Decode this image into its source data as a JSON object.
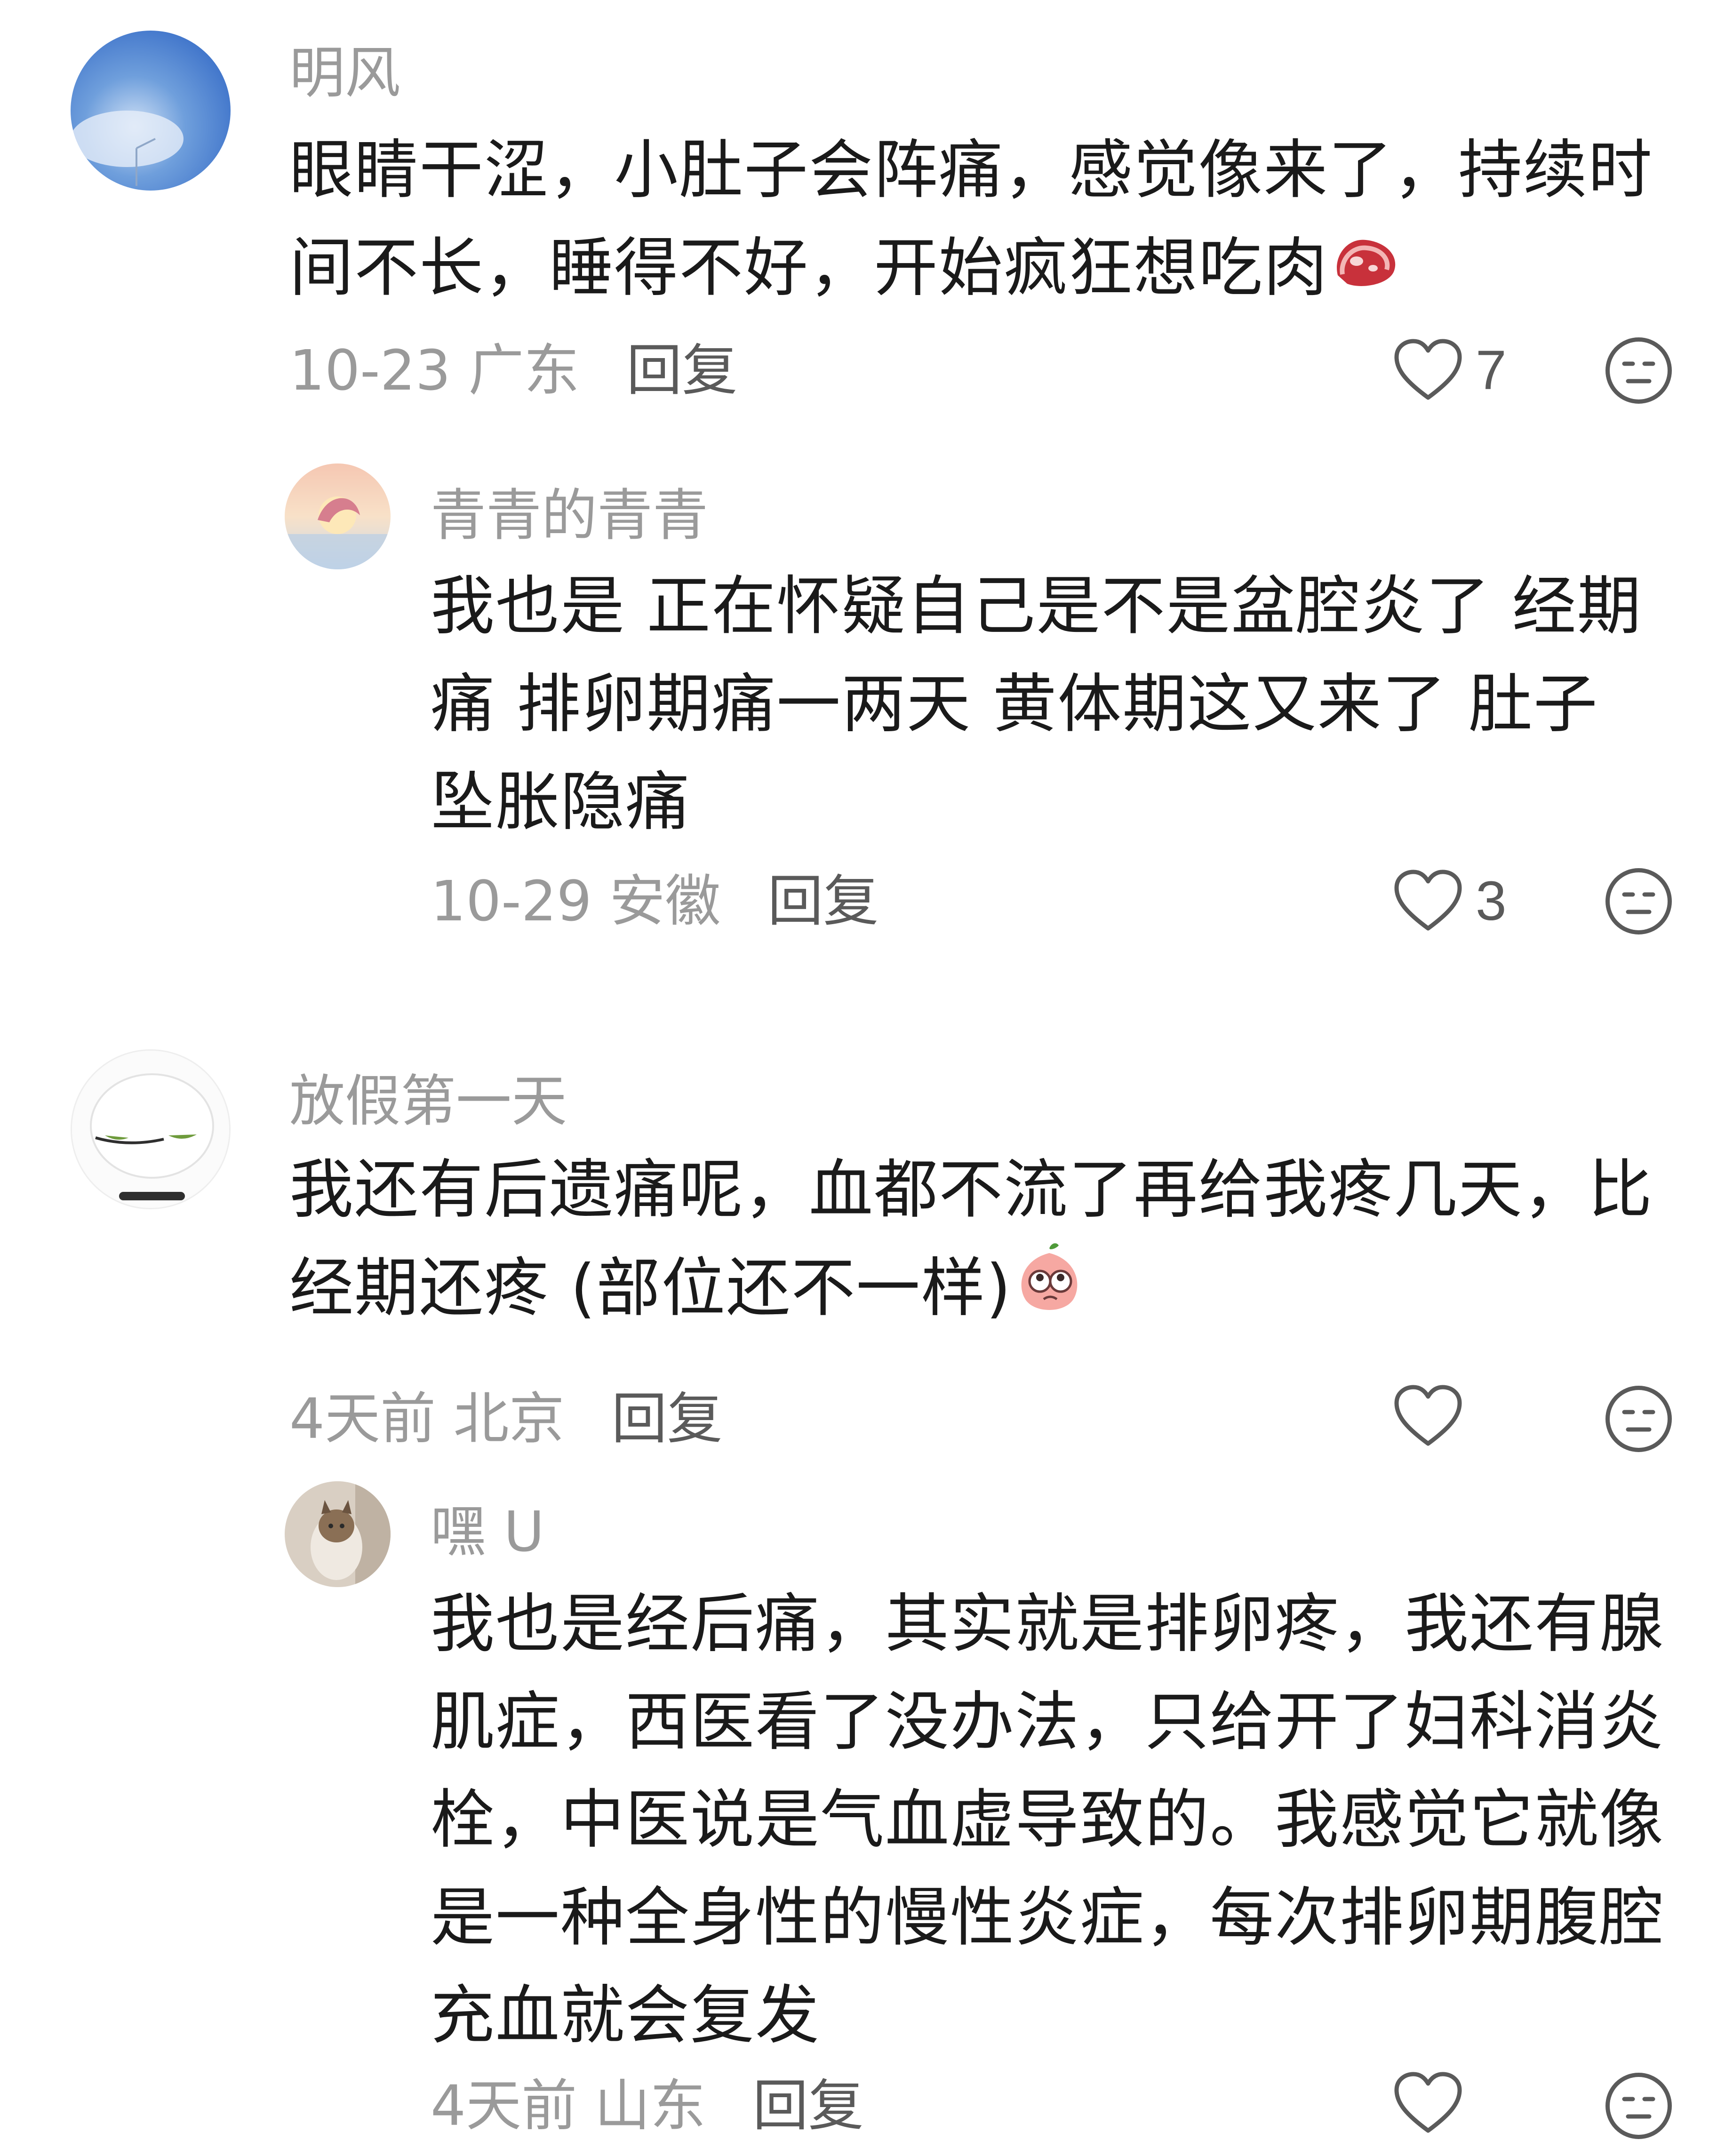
{
  "comments": [
    {
      "username": "明风",
      "text": "眼睛干涩，小肚子会阵痛，感觉像来了，持续时间不长，睡得不好，开始疯狂想吃肉",
      "emoji": "steak-emoji",
      "date_location": "10-23 广东",
      "reply_label": "回复",
      "likes": "7"
    },
    {
      "username": "青青的青青",
      "text": "我也是 正在怀疑自己是不是盆腔炎了 经期痛 排卵期痛一两天 黄体期这又来了 肚子坠胀隐痛",
      "date_location": "10-29 安徽",
      "reply_label": "回复",
      "likes": "3"
    },
    {
      "username": "放假第一天",
      "text": "我还有后遗痛呢，血都不流了再给我疼几天，比经期还疼 (部位还不一样)",
      "emoji": "peach-eyes-emoji",
      "date_location": "4天前 北京",
      "reply_label": "回复",
      "likes": ""
    },
    {
      "username": "嘿 U",
      "text": "我也是经后痛，其实就是排卵疼，我还有腺肌症，西医看了没办法，只给开了妇科消炎栓，中医说是气血虚导致的。我感觉它就像是一种全身性的慢性炎症，每次排卵期腹腔充血就会复发",
      "date_location": "4天前 山东",
      "reply_label": "回复",
      "likes": ""
    }
  ],
  "colors": {
    "username": "#9a9a9a",
    "text": "#1a1a1a",
    "meta": "#9a9a9a",
    "reply": "#5a5a5a",
    "icon": "#5a5a5a"
  }
}
